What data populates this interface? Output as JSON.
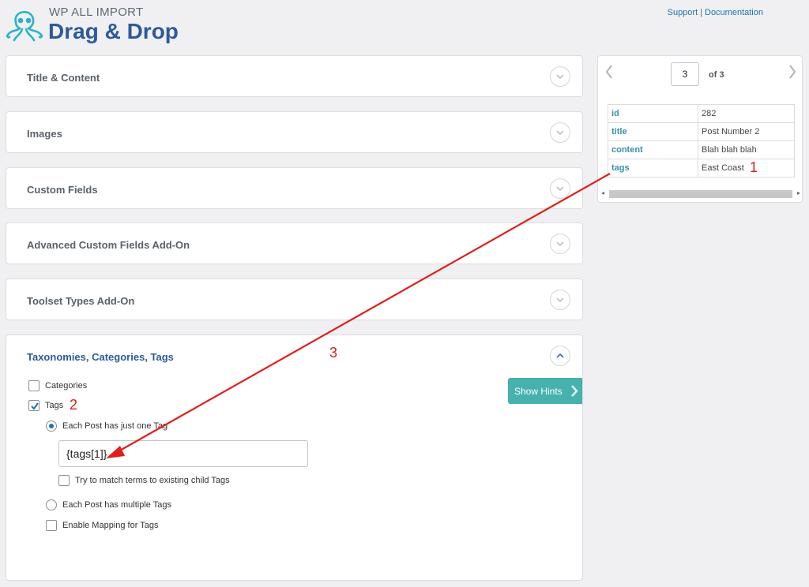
{
  "brand": {
    "small": "WP ALL IMPORT",
    "big": "Drag & Drop"
  },
  "top_links": {
    "support": "Support",
    "separator": "|",
    "documentation": "Documentation"
  },
  "panels": [
    {
      "title": "Title & Content"
    },
    {
      "title": "Images"
    },
    {
      "title": "Custom Fields"
    },
    {
      "title": "Advanced Custom Fields Add-On"
    },
    {
      "title": "Toolset Types Add-On"
    }
  ],
  "taxonomies": {
    "title": "Taxonomies, Categories, Tags",
    "categories_label": "Categories",
    "categories_checked": false,
    "tags_label": "Tags",
    "tags_checked": true,
    "single_tag_label": "Each Post has just one Tag",
    "single_tag_selected": true,
    "tag_input_value": "{tags[1]}",
    "match_child_label": "Try to match terms to existing child Tags",
    "multiple_tags_label": "Each Post has multiple Tags",
    "mapping_label": "Enable Mapping for Tags"
  },
  "show_hints": "Show Hints",
  "record": {
    "current": "3",
    "of_label": "of 3",
    "rows": [
      {
        "key": "id",
        "value": "282"
      },
      {
        "key": "title",
        "value": "Post Number 2"
      },
      {
        "key": "content",
        "value": "Blah blah blah"
      },
      {
        "key": "tags",
        "value": "East Coast"
      }
    ]
  },
  "annotations": {
    "a1": "1",
    "a2": "2",
    "a3": "3"
  },
  "colors": {
    "brand_blue": "#2e5a9a",
    "teal": "#46b1ad",
    "annotation_red": "#d9201b",
    "link_blue": "#2271b1"
  },
  "icons": [
    "octopus-logo-icon",
    "chevron-down-icon",
    "chevron-up-icon",
    "chevron-left-icon",
    "chevron-right-icon",
    "checkmark-icon"
  ]
}
